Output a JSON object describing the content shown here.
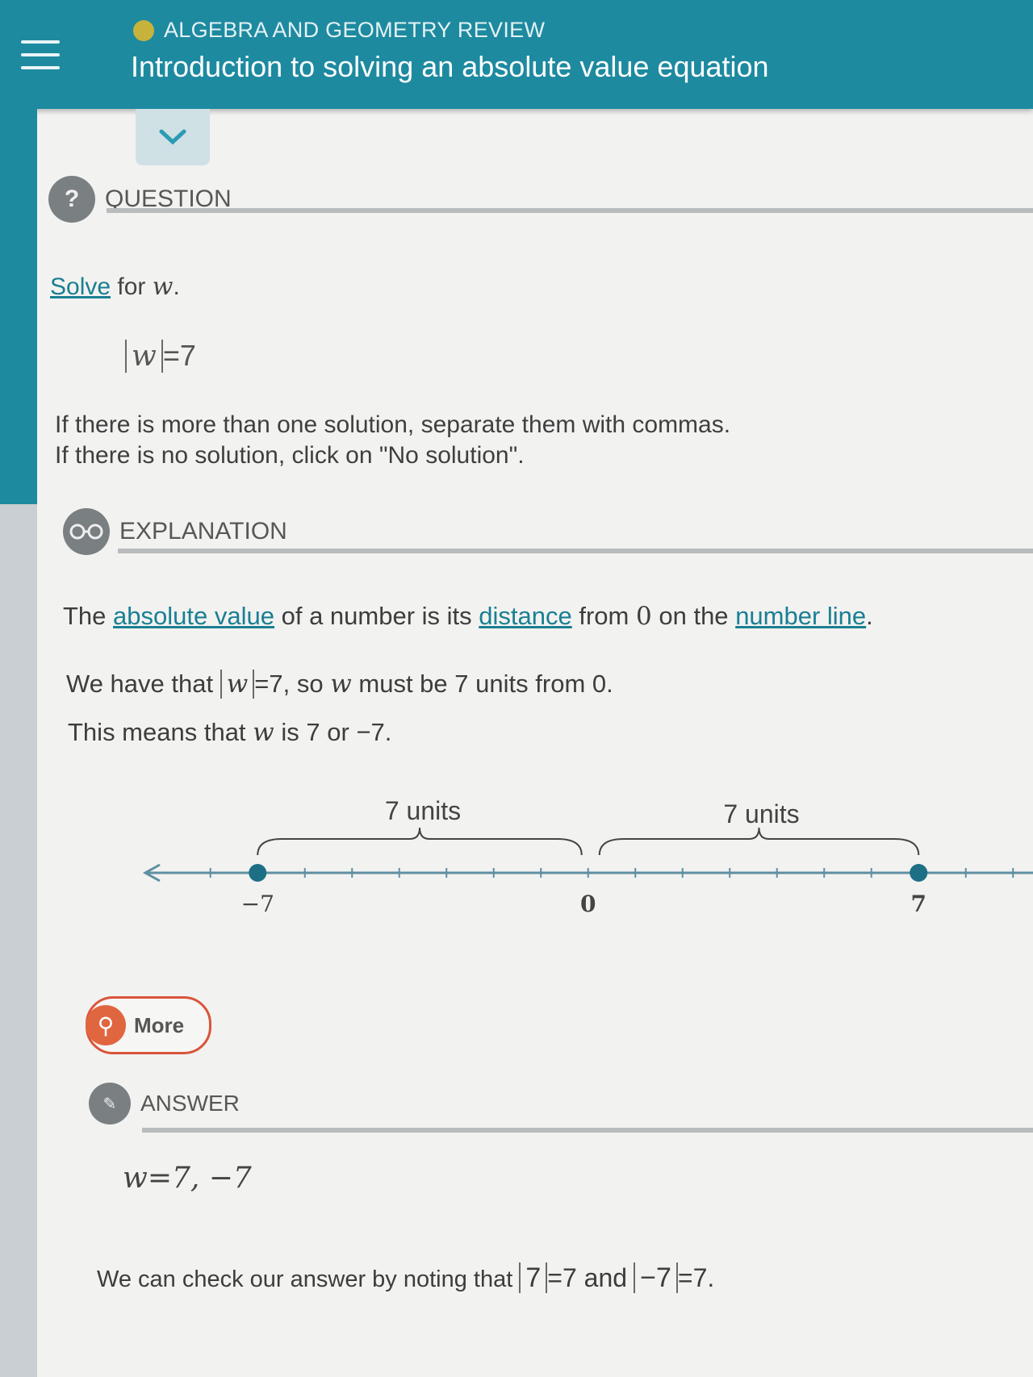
{
  "header": {
    "topic": "ALGEBRA AND GEOMETRY REVIEW",
    "title": "Introduction to solving an absolute value equation"
  },
  "question": {
    "section_label": "QUESTION",
    "solve_link": "Solve",
    "prompt_rest": "for",
    "variable": "w",
    "period": ".",
    "equation_var": "w",
    "equation_rhs": "=7",
    "instruction_1": "If there is more than one solution, separate them with commas.",
    "instruction_2": "If there is no solution, click on \"No solution\"."
  },
  "explanation": {
    "section_label": "EXPLANATION",
    "line1_a": "The",
    "line1_link1": "absolute value",
    "line1_b": "of a number is its",
    "line1_link2": "distance",
    "line1_c": "from",
    "line1_zero": "0",
    "line1_d": "on the",
    "line1_link3": "number line",
    "line1_end": ".",
    "line2_a": "We have that",
    "line2_var": "w",
    "line2_b": "=7, so",
    "line2_var2": "w",
    "line2_c": "must be",
    "line2_seven": "7",
    "line2_d": "units from",
    "line2_zero": "0",
    "line2_end": ".",
    "line3_a": "This means that",
    "line3_var": "w",
    "line3_b": "is",
    "line3_seven": "7",
    "line3_c": "or",
    "line3_neg": "−7",
    "line3_end": ".",
    "number_line": {
      "min": -7.5,
      "max": 9,
      "points": [
        -7,
        7
      ],
      "labels": [
        "−7",
        "0",
        "7"
      ],
      "left_brace_label": "7 units",
      "right_brace_label": "7 units",
      "line_color": "#5f8fa2",
      "point_color": "#1d6f86"
    },
    "more_button": "More"
  },
  "answer": {
    "section_label": "ANSWER",
    "value": "w=7, −7",
    "check_a": "We can check our answer by noting that",
    "check_abs1": "7",
    "check_b": "=7 and",
    "check_abs2": "−7",
    "check_c": "=7."
  },
  "colors": {
    "header": "#1d8aa0",
    "link": "#1a7f93",
    "more_accent": "#e0663f"
  }
}
